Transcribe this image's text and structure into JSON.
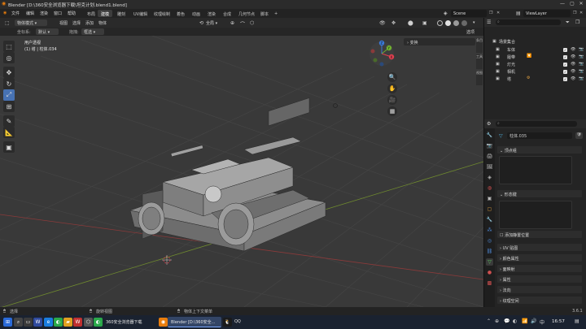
{
  "window": {
    "title": "Blender [D:\\360安全浏览器下载\\坦克计划.blend1.blend]",
    "minimize": "—",
    "maximize": "▢",
    "close": "✕"
  },
  "menu": {
    "logo": "◉",
    "items": [
      "文件",
      "编辑",
      "渲染",
      "窗口",
      "帮助"
    ],
    "workspaces": [
      "布局",
      "建模",
      "雕刻",
      "UV编辑",
      "纹理绘制",
      "着色",
      "动画",
      "渲染",
      "合成",
      "几何节点",
      "脚本"
    ],
    "active_workspace": "建模",
    "add_tab": "+",
    "scene": "Scene",
    "viewlayer": "ViewLayer"
  },
  "header": {
    "mode": "物体模式",
    "menu_items": [
      "视图",
      "选择",
      "添加",
      "物体"
    ],
    "transform": "全局",
    "snap_icons": [
      "⊕",
      "⌒",
      "⬡"
    ]
  },
  "header2": {
    "orientation_label": "坐标系:",
    "orientation_value": "默认",
    "drag_label": "拖拽:",
    "drag_value": "框选",
    "options": "选项"
  },
  "viewport": {
    "overlay_title": "用户透视",
    "overlay_object": "(1) 塔 | 柱体.034",
    "sidebar_tabs": [
      "条目",
      "工具",
      "视图"
    ],
    "panel_label": "变换",
    "gizmo": {
      "x": "X",
      "y": "Y",
      "z": "Z"
    },
    "nav": [
      "🔍",
      "✋",
      "🎥",
      "▦"
    ]
  },
  "tools": [
    {
      "name": "select-tool-icon",
      "glyph": "⬚",
      "active": false
    },
    {
      "name": "cursor-tool-icon",
      "glyph": "◎",
      "active": false
    },
    {
      "name": "move-tool-icon",
      "glyph": "✥",
      "active": false
    },
    {
      "name": "rotate-tool-icon",
      "glyph": "↻",
      "active": false
    },
    {
      "name": "scale-tool-icon",
      "glyph": "⤢",
      "active": true
    },
    {
      "name": "transform-tool-icon",
      "glyph": "⊞",
      "active": false
    },
    {
      "name": "annotate-tool-icon",
      "glyph": "✎",
      "active": false
    },
    {
      "name": "measure-tool-icon",
      "glyph": "📐",
      "active": false
    },
    {
      "name": "add-cube-tool-icon",
      "glyph": "▣",
      "active": false
    }
  ],
  "outliner": {
    "search_placeholder": "",
    "root": "场景集合",
    "items": [
      {
        "label": "车体",
        "extra": ""
      },
      {
        "label": "履带",
        "extra": "🔽"
      },
      {
        "label": "灯光",
        "extra": ""
      },
      {
        "label": "相机",
        "extra": ""
      },
      {
        "label": "塔",
        "extra": "⚙"
      }
    ]
  },
  "properties": {
    "object_name": "柱体.035",
    "sections": [
      {
        "label": "顶点组"
      },
      {
        "label": "形态键"
      },
      {
        "label": "添加静置位置"
      },
      {
        "label": "UV 贴图"
      },
      {
        "label": "颜色属性"
      },
      {
        "label": "面映射"
      },
      {
        "label": "属性"
      },
      {
        "label": "法向"
      },
      {
        "label": "纹理空间"
      },
      {
        "label": "重构网格"
      }
    ]
  },
  "status": {
    "left": "选择",
    "middle": "旋转视图",
    "right": "物体上下文菜单",
    "version": "3.6.1"
  },
  "taskbar": {
    "apps": [
      {
        "label": "360安全浏览器下载",
        "active": false
      },
      {
        "label": "Blender [D:\\360安全...",
        "active": true
      },
      {
        "label": "QQ",
        "active": false
      }
    ],
    "time": "16:57"
  },
  "colors": {
    "accent": "#4772b3",
    "axis_x": "#e04050",
    "axis_y": "#70b030",
    "axis_z": "#3b7ad8"
  }
}
